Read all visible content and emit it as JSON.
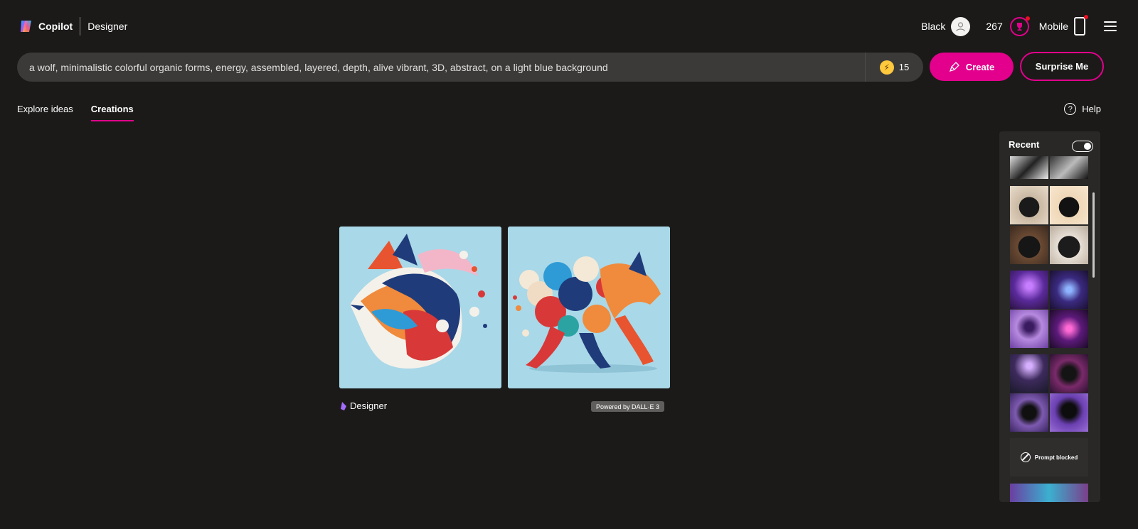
{
  "header": {
    "brand_name": "Copilot",
    "product_name": "Designer",
    "user_name": "Black",
    "boost_total": "267",
    "mobile_label": "Mobile"
  },
  "prompt": {
    "value": "a wolf, minimalistic colorful organic forms, energy, assembled, layered, depth, alive vibrant, 3D, abstract, on a light blue background",
    "boosts_left": "15",
    "bolt_icon": "lightning-icon"
  },
  "buttons": {
    "create_label": "Create",
    "surprise_label": "Surprise Me"
  },
  "tabs": [
    {
      "label": "Explore ideas",
      "active": false
    },
    {
      "label": "Creations",
      "active": true
    }
  ],
  "help": {
    "label": "Help"
  },
  "results": {
    "caption": "Designer",
    "powered_by": "Powered by DALL·E 3"
  },
  "recent": {
    "title": "Recent",
    "toggle_on": true,
    "blocked_label": "Prompt blocked"
  },
  "colors": {
    "background": "#1b1a19",
    "accent": "#e3008c",
    "prompt_bg": "#3b3a39",
    "panel_bg": "#292827"
  }
}
